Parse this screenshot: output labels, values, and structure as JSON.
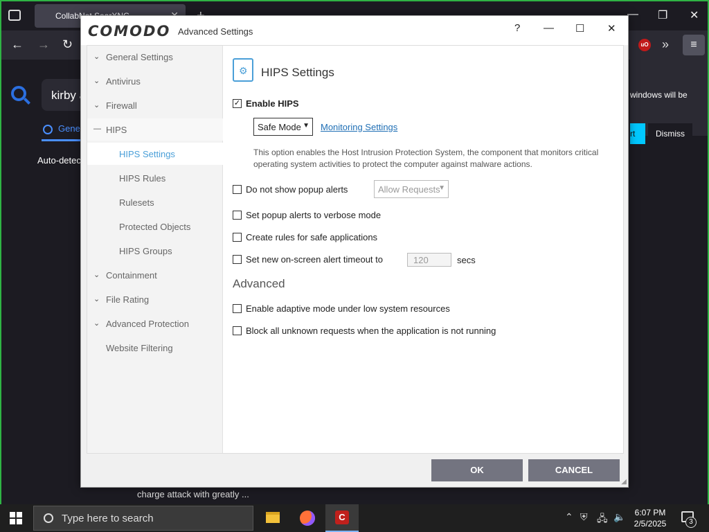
{
  "browser": {
    "tab_title": "CollabNet SearXNG",
    "query": "kirby a",
    "general_tab": "Gener",
    "autodetect": "Auto-detec",
    "notification_text": "windows will be",
    "notification_start": "rt",
    "notification_dismiss": "Dismiss",
    "bottom_snippet": "charge attack with greatly ..."
  },
  "dialog": {
    "logo": "COMODO",
    "title": "Advanced Settings",
    "help": "?",
    "minimize": "—",
    "maximize": "☐",
    "close": "✕"
  },
  "sidebar": {
    "items": [
      {
        "label": "General Settings",
        "chevron": "⌄"
      },
      {
        "label": "Antivirus",
        "chevron": "⌄"
      },
      {
        "label": "Firewall",
        "chevron": "⌄"
      },
      {
        "label": "HIPS",
        "chevron": "—"
      },
      {
        "label": "HIPS Settings"
      },
      {
        "label": "HIPS Rules"
      },
      {
        "label": "Rulesets"
      },
      {
        "label": "Protected Objects"
      },
      {
        "label": "HIPS Groups"
      },
      {
        "label": "Containment",
        "chevron": "⌄"
      },
      {
        "label": "File Rating",
        "chevron": "⌄"
      },
      {
        "label": "Advanced Protection",
        "chevron": "⌄"
      },
      {
        "label": "Website Filtering"
      }
    ]
  },
  "content": {
    "heading": "HIPS Settings",
    "enable_hips": {
      "label": "Enable HIPS",
      "checked": true
    },
    "mode_select": "Safe Mode",
    "monitoring_link": "Monitoring Settings",
    "description": "This option enables the Host Intrusion Protection System, the component that monitors critical operating system activities to protect the computer against malware actions.",
    "no_popup": {
      "label": "Do not show popup alerts",
      "checked": false
    },
    "popup_select": "Allow Requests",
    "verbose": {
      "label": "Set popup alerts to verbose mode",
      "checked": false
    },
    "safe_rules": {
      "label": "Create rules for safe applications",
      "checked": false
    },
    "timeout": {
      "label": "Set new on-screen alert timeout to",
      "checked": false,
      "value": "120",
      "unit": "secs"
    },
    "advanced_heading": "Advanced",
    "adaptive": {
      "label": "Enable adaptive mode under low system resources",
      "checked": false
    },
    "block_unknown": {
      "label": "Block all unknown requests when the application is not running",
      "checked": false
    }
  },
  "buttons": {
    "ok": "OK",
    "cancel": "CANCEL"
  },
  "taskbar": {
    "search_placeholder": "Type here to search",
    "time": "6:07 PM",
    "date": "2/5/2025",
    "notification_count": "3"
  },
  "colors": {
    "accent": "#4a9fd8",
    "button": "#737480",
    "frame": "#2fb344"
  }
}
